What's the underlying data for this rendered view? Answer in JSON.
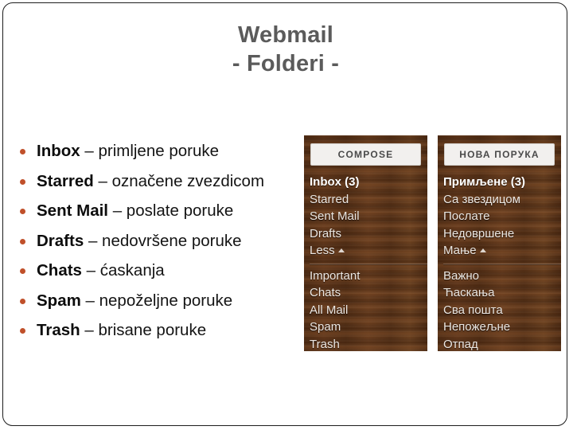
{
  "slide": {
    "title_line1": "Webmail",
    "title_line2": "- Folderi -",
    "accent_color": "#c0502a",
    "title_color": "#5b5b5b"
  },
  "bullets": [
    {
      "term": "Inbox",
      "dash": " – ",
      "desc": "primljene poruke"
    },
    {
      "term": "Starred",
      "dash": " – ",
      "desc": "označene zvezdicom"
    },
    {
      "term": "Sent Mail",
      "dash": " – ",
      "desc": "poslate poruke"
    },
    {
      "term": "Drafts",
      "dash": " – ",
      "desc": "nedovršene poruke"
    },
    {
      "term": "Chats",
      "dash": " – ",
      "desc": "ćaskanja"
    },
    {
      "term": "Spam",
      "dash": " – ",
      "desc": "nepoželjne poruke"
    },
    {
      "term": "Trash",
      "dash": " – ",
      "desc": "brisane poruke"
    }
  ],
  "panel_left": {
    "compose_label": "COMPOSE",
    "folders_top": [
      {
        "label": "Inbox (3)",
        "bold": true
      },
      {
        "label": "Starred",
        "bold": false
      },
      {
        "label": "Sent Mail",
        "bold": false
      },
      {
        "label": "Drafts",
        "bold": false
      }
    ],
    "less_label": "Less",
    "folders_bottom": [
      {
        "label": "Important",
        "bold": false
      },
      {
        "label": "Chats",
        "bold": false
      },
      {
        "label": "All Mail",
        "bold": false
      },
      {
        "label": "Spam",
        "bold": false
      },
      {
        "label": "Trash",
        "bold": false
      }
    ]
  },
  "panel_right": {
    "compose_label": "НОВА ПОРУКА",
    "folders_top": [
      {
        "label": "Примљене (3)",
        "bold": true
      },
      {
        "label": "Са звездицом",
        "bold": false
      },
      {
        "label": "Послате",
        "bold": false
      },
      {
        "label": "Недовршене",
        "bold": false
      }
    ],
    "less_label": "Мање",
    "folders_bottom": [
      {
        "label": "Важно",
        "bold": false
      },
      {
        "label": "Ћаскања",
        "bold": false
      },
      {
        "label": "Сва пошта",
        "bold": false
      },
      {
        "label": "Непожељне",
        "bold": false
      },
      {
        "label": "Отпад",
        "bold": false
      }
    ]
  }
}
